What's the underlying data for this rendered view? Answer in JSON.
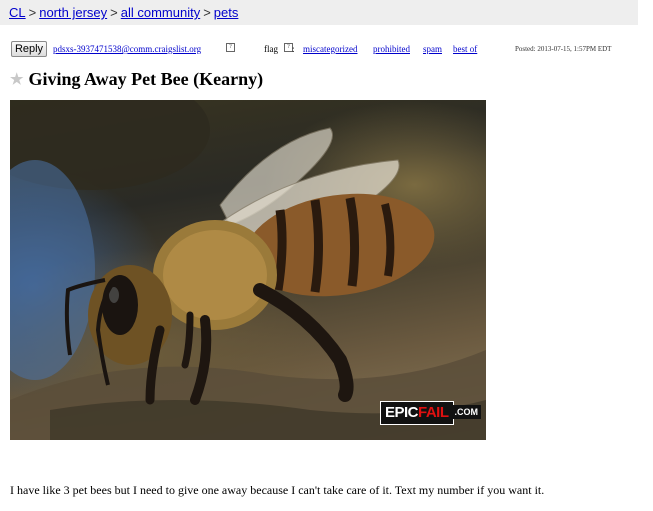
{
  "breadcrumb": {
    "items": [
      "CL",
      "north jersey",
      "all community",
      "pets"
    ],
    "separator": ">"
  },
  "posting": {
    "reply_label": "Reply",
    "reply_email": "pdsxs-3937471538@comm.craigslist.org",
    "help_glyph": "?",
    "flag_label": "flag",
    "flag_colon": ":",
    "flags": [
      "miscategorized",
      "prohibited",
      "spam",
      "best of"
    ],
    "posted": "Posted: 2013-07-15, 1:57PM EDT"
  },
  "title": "Giving Away Pet Bee (Kearny)",
  "title_icon": "star-icon",
  "watermark": {
    "epic": "EPIC",
    "fail": "FAIL",
    "com": ".COM"
  },
  "body": "I have like 3 pet bees but I need to give one away because I can't take care of it. Text my number if you want it.",
  "colors": {
    "link": "#0000cc",
    "crumb_bg": "#eeeeee",
    "star": "#c8c8c8",
    "fail": "#e01010"
  }
}
